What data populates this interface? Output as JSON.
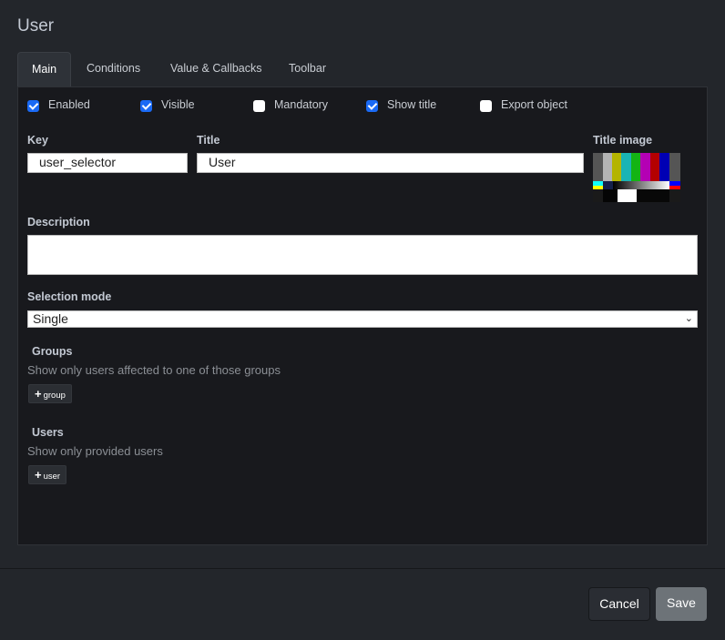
{
  "dialog": {
    "title": "User"
  },
  "tabs": [
    {
      "label": "Main",
      "active": true
    },
    {
      "label": "Conditions"
    },
    {
      "label": "Value & Callbacks"
    },
    {
      "label": "Toolbar"
    }
  ],
  "checkboxes": [
    {
      "label": "Enabled",
      "checked": true
    },
    {
      "label": "Visible",
      "checked": true
    },
    {
      "label": "Mandatory",
      "checked": false
    },
    {
      "label": "Show title",
      "checked": true
    },
    {
      "label": "Export object",
      "checked": false
    }
  ],
  "fields": {
    "key": {
      "label": "Key",
      "value": "user_selector"
    },
    "title": {
      "label": "Title",
      "value": "User"
    },
    "title_image": {
      "label": "Title image"
    },
    "description": {
      "label": "Description",
      "value": ""
    },
    "selection_mode": {
      "label": "Selection mode",
      "value": "Single"
    }
  },
  "groups": {
    "label": "Groups",
    "description": "Show only users affected to one of those groups",
    "add_label": "group"
  },
  "users": {
    "label": "Users",
    "description": "Show only provided users",
    "add_label": "user"
  },
  "footer": {
    "cancel": "Cancel",
    "save": "Save"
  }
}
